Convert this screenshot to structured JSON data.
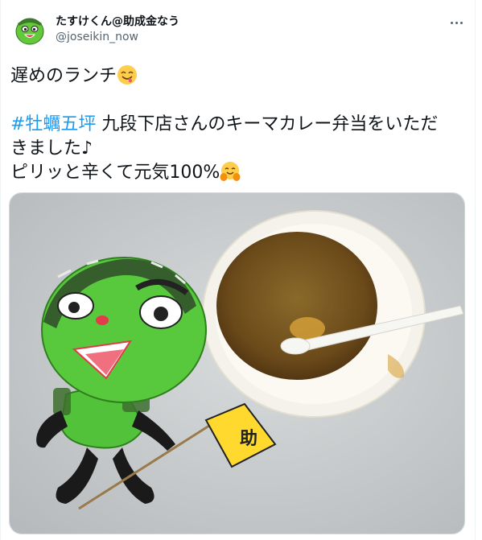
{
  "tweet": {
    "author": {
      "display_name": "たすけくん@助成金なう",
      "handle": "@joseikin_now"
    },
    "menu_icon": "more-dots-icon",
    "lines": [
      {
        "text": "遅めのランチ",
        "emoji": "savoring-food-emoji"
      },
      {
        "text": ""
      },
      {
        "hashtag": "#牡蠣五坪",
        "text": " 九段下店さんのキーマカレー弁当をいただ"
      },
      {
        "text": "きました♪"
      },
      {
        "text": "ピリッと辛くて元気100%",
        "emoji": "hugging-face-emoji"
      }
    ],
    "colors": {
      "link": "#1d9bf0",
      "text": "#0f1419",
      "secondary": "#536471"
    },
    "photo": {
      "description_icon": "photo",
      "flag_text": "助"
    }
  }
}
